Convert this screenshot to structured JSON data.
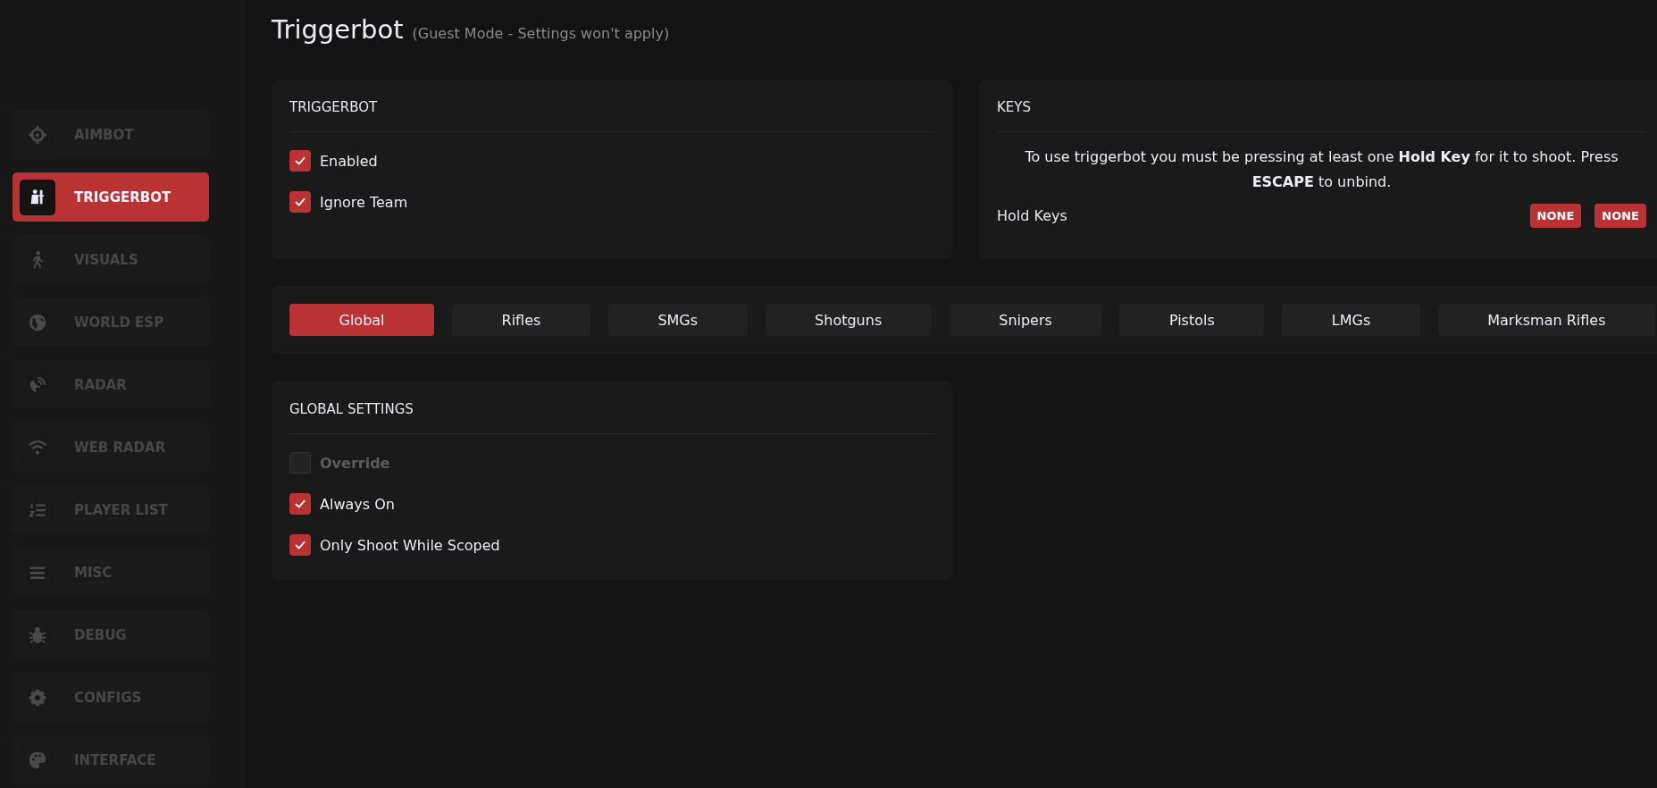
{
  "sidebar": {
    "items": [
      {
        "label": "AIMBOT",
        "selected": false
      },
      {
        "label": "TRIGGERBOT",
        "selected": true
      },
      {
        "label": "VISUALS",
        "selected": false
      },
      {
        "label": "WORLD ESP",
        "selected": false
      },
      {
        "label": "RADAR",
        "selected": false
      },
      {
        "label": "WEB RADAR",
        "selected": false
      },
      {
        "label": "PLAYER LIST",
        "selected": false
      },
      {
        "label": "MISC",
        "selected": false
      },
      {
        "label": "DEBUG",
        "selected": false
      },
      {
        "label": "CONFIGS",
        "selected": false
      },
      {
        "label": "INTERFACE",
        "selected": false
      }
    ]
  },
  "header": {
    "title": "Triggerbot",
    "subtitle": "(Guest Mode - Settings won't apply)"
  },
  "triggerbot_panel": {
    "title": "TRIGGERBOT",
    "options": [
      {
        "label": "Enabled",
        "checked": true,
        "disabled": false
      },
      {
        "label": "Ignore Team",
        "checked": true,
        "disabled": false
      }
    ]
  },
  "keys_panel": {
    "title": "KEYS",
    "note": "To use triggerbot you must be pressing at least one **Hold Key** for it to shoot. Press **ESCAPE** to unbind.",
    "hold_keys_label": "Hold Keys",
    "hold_keys": [
      "NONE",
      "NONE"
    ]
  },
  "weapon_tabs": [
    {
      "label": "Global",
      "selected": true
    },
    {
      "label": "Rifles",
      "selected": false
    },
    {
      "label": "SMGs",
      "selected": false
    },
    {
      "label": "Shotguns",
      "selected": false
    },
    {
      "label": "Snipers",
      "selected": false
    },
    {
      "label": "Pistols",
      "selected": false
    },
    {
      "label": "LMGs",
      "selected": false
    },
    {
      "label": "Marksman Rifles",
      "selected": false
    }
  ],
  "global_settings_panel": {
    "title": "GLOBAL SETTINGS",
    "options": [
      {
        "label": "Override",
        "checked": false,
        "disabled": true
      },
      {
        "label": "Always On",
        "checked": true,
        "disabled": false
      },
      {
        "label": "Only Shoot While Scoped",
        "checked": true,
        "disabled": false
      }
    ]
  }
}
